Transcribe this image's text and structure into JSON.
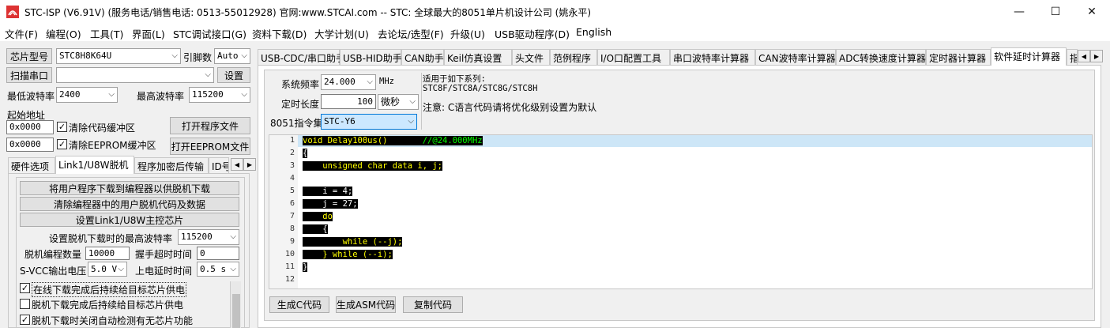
{
  "window": {
    "title": "STC-ISP (V6.91V) (服务电话/销售电话: 0513-55012928) 官网:www.STCAI.com  -- STC: 全球最大的8051单片机设计公司 (姚永平)",
    "minimize": "—",
    "maximize": "☐",
    "close": "✕"
  },
  "menu": [
    "文件(F)",
    "编程(O)",
    "工具(T)",
    "界面(L)",
    "STC调试接口(G)",
    "资料下载(D)",
    "大学计划(U)",
    "去论坛/选型(F)",
    "升级(U)",
    "USB驱动程序(D)",
    "English"
  ],
  "left": {
    "chip_label": "芯片型号",
    "chip_value": "STC8H8K64U",
    "pin_label": "引脚数",
    "pin_value": "Auto",
    "scan_button": "扫描串口",
    "port_value": "",
    "settings_button": "设置",
    "min_baud_label": "最低波特率",
    "min_baud_value": "2400",
    "max_baud_label": "最高波特率",
    "max_baud_value": "115200",
    "start_addr_label": "起始地址",
    "addr1": "0x0000",
    "clear_code_label": "清除代码缓冲区",
    "open_prog_button": "打开程序文件",
    "addr2": "0x0000",
    "clear_eeprom_label": "清除EEPROM缓冲区",
    "open_eeprom_button": "打开EEPROM文件",
    "tabs": [
      "硬件选项",
      "Link1/U8W脱机",
      "程序加密后传输",
      "ID号"
    ],
    "offline": {
      "btn1": "将用户程序下载到编程器以供脱机下载",
      "btn2": "清除编程器中的用户脱机代码及数据",
      "btn3": "设置Link1/U8W主控芯片",
      "max_baud_label": "设置脱机下载时的最高波特率",
      "max_baud_value": "115200",
      "count_label": "脱机编程数量",
      "count_value": "10000",
      "timeout_label": "握手超时时间",
      "timeout_value": "0",
      "svcc_label": "S-VCC输出电压",
      "svcc_value": "5.0 V",
      "delay_label": "上电延时时间",
      "delay_value": "0.5 s",
      "opt1": "在线下载完成后持续给目标芯片供电",
      "opt2": "脱机下载完成后持续给目标芯片供电",
      "opt3": "脱机下载时关闭自动检测有无芯片功能"
    }
  },
  "right": {
    "tabs": [
      "USB-CDC/串口助手",
      "USB-HID助手",
      "CAN助手",
      "Keil仿真设置",
      "头文件",
      "范例程序",
      "I/O口配置工具",
      "串口波特率计算器",
      "CAN波特率计算器",
      "ADC转换速度计算器",
      "定时器计算器",
      "软件延时计算器",
      "指"
    ],
    "freq_label": "系统频率",
    "freq_value": "24.000",
    "freq_unit": "MHz",
    "duration_label": "定时长度",
    "duration_value": "100",
    "duration_unit": "微秒",
    "isa_label": "8051指令集",
    "isa_value": "STC-Y6",
    "info_line1": "适用于如下系列:",
    "info_line2": "STC8F/STC8A/STC8G/STC8H",
    "info_note": "注意: C语言代码请将优化级别设置为默认",
    "code_lines": [
      "void Delay100us()",
      "{",
      "    unsigned char data i, j;",
      "",
      "    i = 4;",
      "    j = 27;",
      "    do",
      "    {",
      "        while (--j);",
      "    } while (--i);",
      "}",
      ""
    ],
    "code_comment": "//@24.000MHz",
    "line_numbers": [
      "1",
      "2",
      "3",
      "4",
      "5",
      "6",
      "7",
      "8",
      "9",
      "10",
      "11",
      "12"
    ],
    "gen_c_button": "生成C代码",
    "gen_asm_button": "生成ASM代码",
    "copy_button": "复制代码"
  }
}
